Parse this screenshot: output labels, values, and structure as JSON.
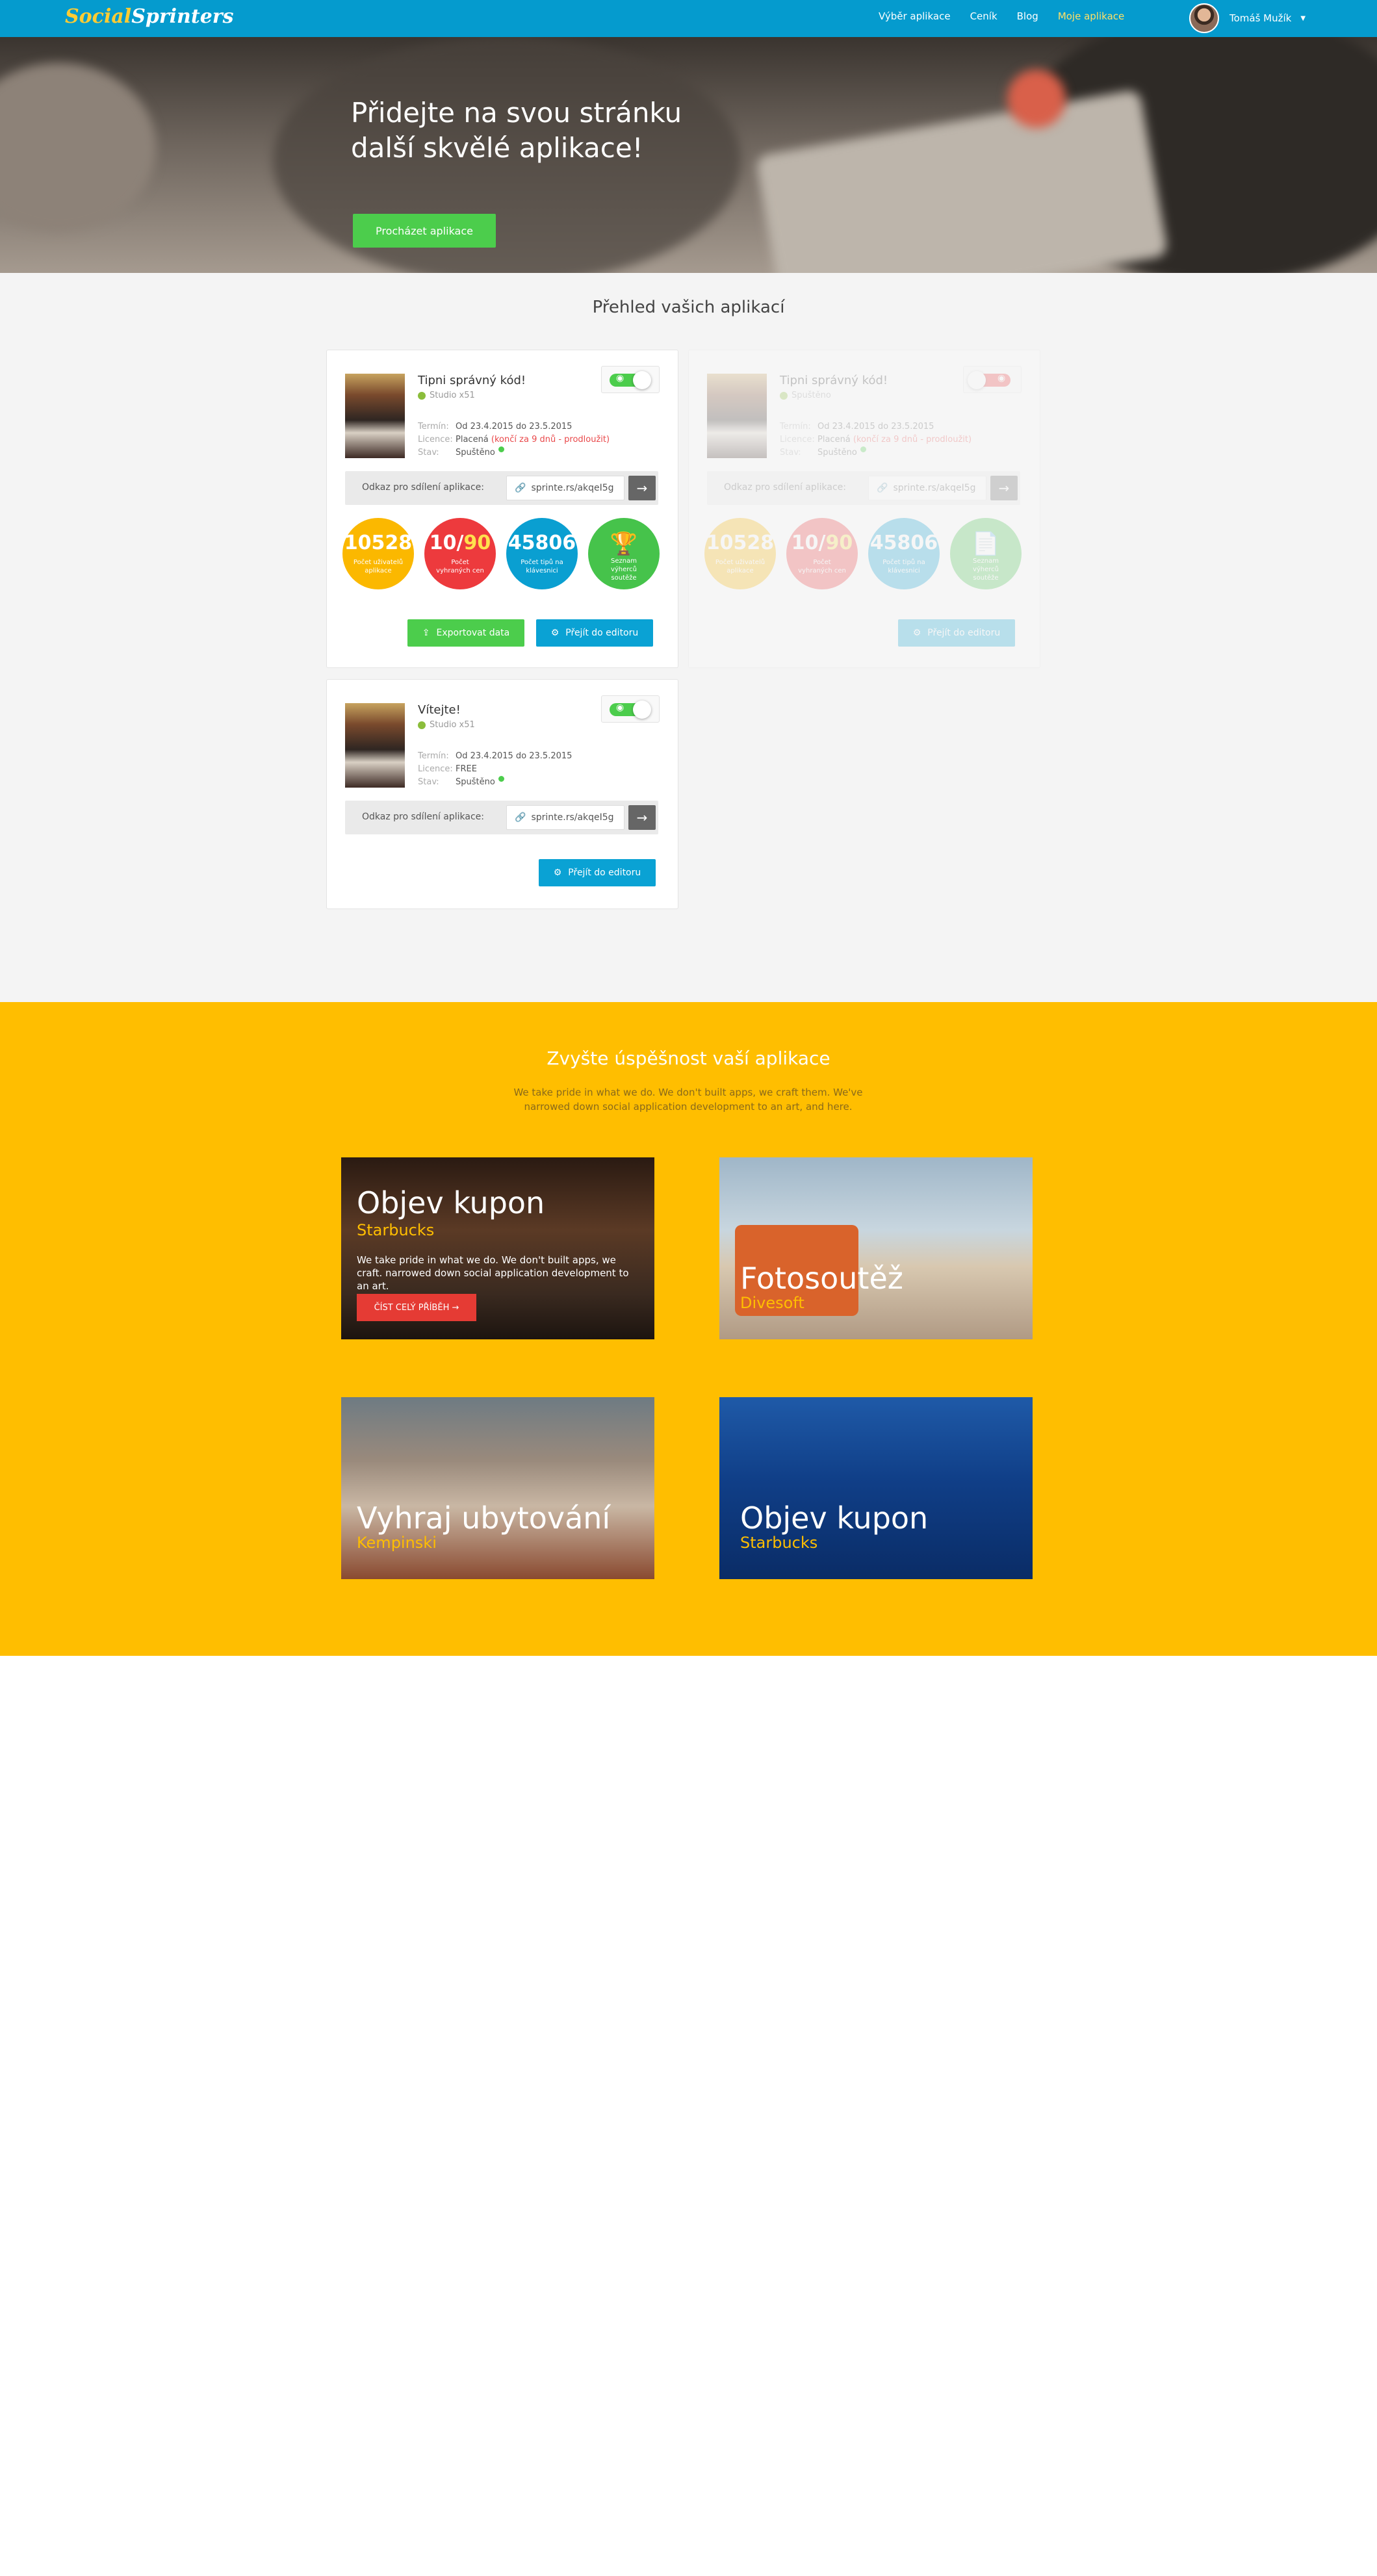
{
  "nav": {
    "logo_part1": "Social",
    "logo_part2": "Sprinters",
    "links": [
      "Výběr aplikace",
      "Ceník",
      "Blog",
      "Moje aplikace"
    ],
    "user_name": "Tomáš Mužík"
  },
  "hero": {
    "title_line1": "Přidejte na svou stránku",
    "title_line2": "další skvělé aplikace!",
    "button": "Procházet aplikace"
  },
  "overview": {
    "title": "Přehled vašich aplikací",
    "labels": {
      "term": "Termín:",
      "license": "Licence:",
      "status": "Stav:",
      "share": "Odkaz pro sdílení aplikace:"
    },
    "cards": [
      {
        "title": "Tipni správný kód!",
        "studio": "Studio x51",
        "term": "Od 23.4.2015 do 23.5.2015",
        "license": "Placená",
        "license_note": "(končí za 9 dnů - prodloužit)",
        "status": "Spuštěno",
        "share_link": "sprinte.rs/akqeI5g",
        "enabled": true,
        "stats": [
          {
            "value": "10528",
            "label": "Počet uživatelů aplikace"
          },
          {
            "value_a": "10/",
            "value_b": "90",
            "label": "Počet vyhraných cen"
          },
          {
            "value": "45806",
            "label": "Počet tipů na klávesnici"
          },
          {
            "label": "Seznam výherců soutěže"
          }
        ],
        "export_button": "Exportovat data",
        "edit_button": "Přejít do editoru"
      },
      {
        "title": "Tipni správný kód!",
        "studio": "Spuštěno",
        "term": "Od 23.4.2015 do 23.5.2015",
        "license": "Placená",
        "license_note": "(končí za 9 dnů - prodloužit)",
        "status": "Spuštěno",
        "share_link": "sprinte.rs/akqeI5g",
        "enabled": false,
        "stats": [
          {
            "value": "10528",
            "label": "Počet uživatelů aplikace"
          },
          {
            "value_a": "10/",
            "value_b": "90",
            "label": "Počet vyhraných cen"
          },
          {
            "value": "45806",
            "label": "Počet tipů na klávesnici"
          },
          {
            "label": "Seznam výherců soutěže"
          }
        ],
        "edit_button": "Přejít do editoru"
      },
      {
        "title": "Vítejte!",
        "studio": "Studio x51",
        "term": "Od 23.4.2015 do 23.5.2015",
        "license": "FREE",
        "status": "Spuštěno",
        "share_link": "sprinte.rs/akqeI5g",
        "enabled": true,
        "edit_button": "Přejít do editoru"
      }
    ]
  },
  "promo": {
    "title": "Zvyšte úspěšnost vaší aplikace",
    "subtitle": "We take pride in what we do. We don't built apps, we craft them. We've narrowed down social application development to an art, and here.",
    "tiles": [
      {
        "title": "Objev kupon",
        "brand": "Starbucks",
        "desc": "We take pride in what we do. We don't built apps, we craft. narrowed down social application development to an art.",
        "button": "ČÍST CELÝ PŘÍBĚH →"
      },
      {
        "title": "Fotosoutěž",
        "brand": "Divesoft"
      },
      {
        "title": "Vyhraj ubytování",
        "brand": "Kempinski"
      },
      {
        "title": "Objev kupon",
        "brand": "Starbucks"
      }
    ]
  },
  "colors": {
    "nav": "#059bce",
    "green": "#4ccd4c",
    "blue": "#0aa2d4",
    "red": "#ed3a3d",
    "yellow": "#ffbe00"
  }
}
